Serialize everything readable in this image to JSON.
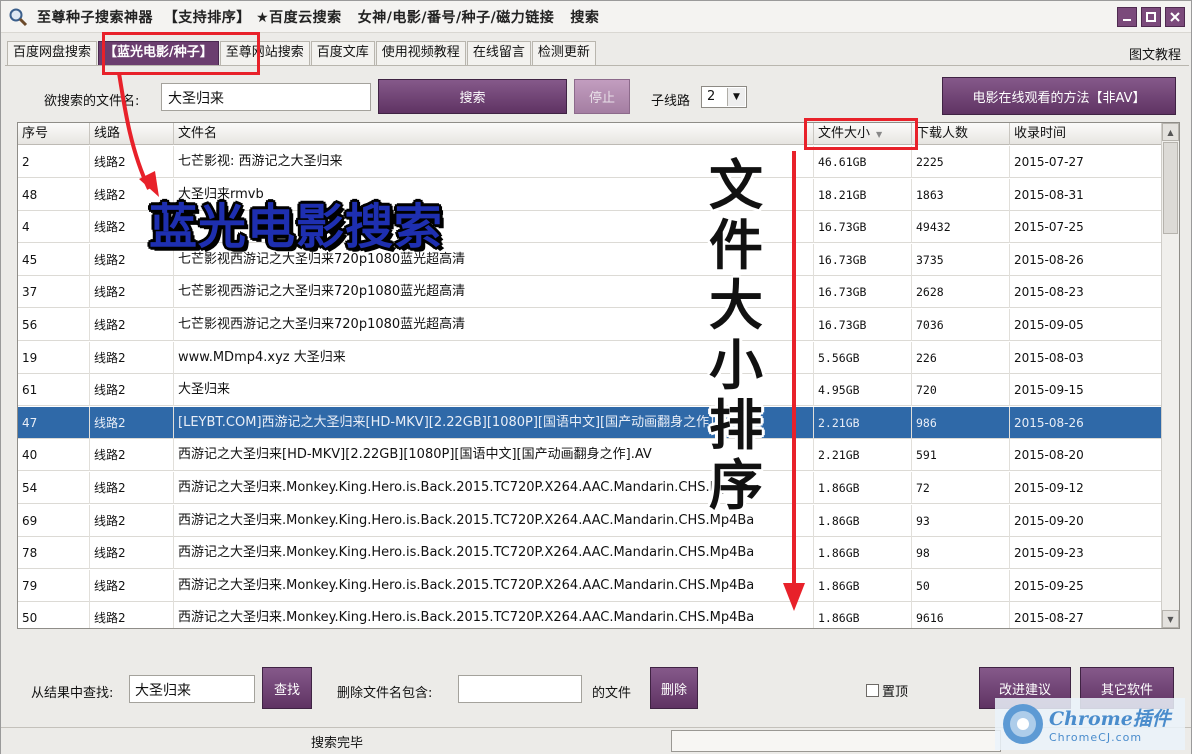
{
  "window": {
    "title": "至尊种子搜索神器  【支持排序】 ★百度云搜索   女神/电影/番号/种子/磁力链接   搜索"
  },
  "tabs": [
    {
      "label": "百度网盘搜索"
    },
    {
      "label": "【蓝光电影/种子】"
    },
    {
      "label": "至尊网站搜索"
    },
    {
      "label": "百度文库"
    },
    {
      "label": "使用视频教程"
    },
    {
      "label": "在线留言"
    },
    {
      "label": "检测更新"
    }
  ],
  "help_link": "图文教程",
  "search": {
    "label": "欲搜索的文件名:",
    "value": "大圣归来",
    "search_button": "搜索",
    "stop_button": "停止",
    "sub_route_label": "子线路",
    "sub_route_value": "2",
    "online_button": "电影在线观看的方法【非AV】"
  },
  "table": {
    "columns": [
      "序号",
      "线路",
      "文件名",
      "文件大小",
      "下载人数",
      "收录时间"
    ],
    "selected_row": 8,
    "rows": [
      {
        "id": "2",
        "route": "线路2",
        "name": "七芒影视: 西游记之大圣归来",
        "size": "46.61GB",
        "downloads": "2225",
        "date": "2015-07-27"
      },
      {
        "id": "48",
        "route": "线路2",
        "name": "大圣归来rmvb",
        "size": "18.21GB",
        "downloads": "1863",
        "date": "2015-08-31"
      },
      {
        "id": "4",
        "route": "线路2",
        "name": "",
        "size": "16.73GB",
        "downloads": "49432",
        "date": "2015-07-25"
      },
      {
        "id": "45",
        "route": "线路2",
        "name": "七芒影视西游记之大圣归来720p1080蓝光超高清",
        "size": "16.73GB",
        "downloads": "3735",
        "date": "2015-08-26"
      },
      {
        "id": "37",
        "route": "线路2",
        "name": "七芒影视西游记之大圣归来720p1080蓝光超高清",
        "size": "16.73GB",
        "downloads": "2628",
        "date": "2015-08-23"
      },
      {
        "id": "56",
        "route": "线路2",
        "name": "七芒影视西游记之大圣归来720p1080蓝光超高清",
        "size": "16.73GB",
        "downloads": "7036",
        "date": "2015-09-05"
      },
      {
        "id": "19",
        "route": "线路2",
        "name": "www.MDmp4.xyz 大圣归来",
        "size": "5.56GB",
        "downloads": "226",
        "date": "2015-08-03"
      },
      {
        "id": "61",
        "route": "线路2",
        "name": "大圣归来",
        "size": "4.95GB",
        "downloads": "720",
        "date": "2015-09-15"
      },
      {
        "id": "47",
        "route": "线路2",
        "name": "[LEYBT.COM]西游记之大圣归来[HD-MKV][2.22GB][1080P][国语中文][国产动画翻身之作].AV",
        "size": "2.21GB",
        "downloads": "986",
        "date": "2015-08-26"
      },
      {
        "id": "40",
        "route": "线路2",
        "name": "西游记之大圣归来[HD-MKV][2.22GB][1080P][国语中文][国产动画翻身之作].AV",
        "size": "2.21GB",
        "downloads": "591",
        "date": "2015-08-20"
      },
      {
        "id": "54",
        "route": "线路2",
        "name": "西游记之大圣归来.Monkey.King.Hero.is.Back.2015.TC720P.X264.AAC.Mandarin.CHS.Mp4Ba",
        "size": "1.86GB",
        "downloads": "72",
        "date": "2015-09-12"
      },
      {
        "id": "69",
        "route": "线路2",
        "name": "西游记之大圣归来.Monkey.King.Hero.is.Back.2015.TC720P.X264.AAC.Mandarin.CHS.Mp4Ba",
        "size": "1.86GB",
        "downloads": "93",
        "date": "2015-09-20"
      },
      {
        "id": "78",
        "route": "线路2",
        "name": "西游记之大圣归来.Monkey.King.Hero.is.Back.2015.TC720P.X264.AAC.Mandarin.CHS.Mp4Ba",
        "size": "1.86GB",
        "downloads": "98",
        "date": "2015-09-23"
      },
      {
        "id": "79",
        "route": "线路2",
        "name": "西游记之大圣归来.Monkey.King.Hero.is.Back.2015.TC720P.X264.AAC.Mandarin.CHS.Mp4Ba",
        "size": "1.86GB",
        "downloads": "50",
        "date": "2015-09-25"
      },
      {
        "id": "50",
        "route": "线路2",
        "name": "西游记之大圣归来.Monkey.King.Hero.is.Back.2015.TC720P.X264.AAC.Mandarin.CHS.Mp4Ba",
        "size": "1.86GB",
        "downloads": "9616",
        "date": "2015-08-27"
      }
    ]
  },
  "annotations": {
    "blue_text": "蓝光电影搜索",
    "vertical_text": "文件大小排序",
    "highlight_color": "#e8212a"
  },
  "bottom": {
    "find_label": "从结果中查找:",
    "find_value": "大圣归来",
    "find_button": "查找",
    "delete_label": "删除文件名包含:",
    "delete_value": "",
    "delete_suffix": "的文件",
    "delete_button": "删除",
    "pin_label": "置顶",
    "suggest_button": "改进建议",
    "other_button": "其它软件"
  },
  "status": {
    "text": "搜索完毕"
  },
  "watermark": {
    "main": "Chrome插件",
    "sub": "ChromeCJ.com"
  },
  "colors": {
    "accent": "#6b3e6f",
    "selection": "#2f69a8"
  }
}
